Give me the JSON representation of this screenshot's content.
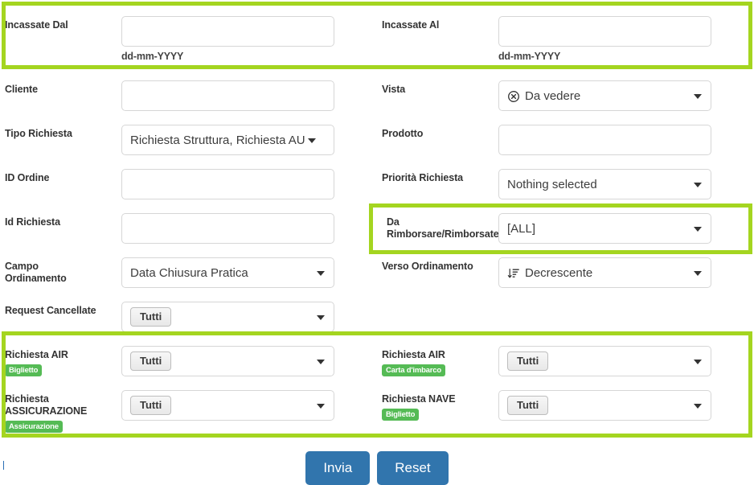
{
  "colors": {
    "highlight_green": "#a4d520",
    "badge_green": "#55bb55",
    "button_blue": "#3175ad"
  },
  "form": {
    "rows": [
      {
        "left": {
          "label": "Incassate Dal",
          "type": "text",
          "value": "",
          "hint": "dd-mm-YYYY"
        },
        "right": {
          "label": "Incassate Al",
          "type": "text",
          "value": "",
          "hint": "dd-mm-YYYY"
        }
      },
      {
        "left": {
          "label": "Cliente",
          "type": "text",
          "value": ""
        },
        "right": {
          "label": "Vista",
          "type": "select",
          "value": "Da vedere",
          "icon": "circle-x-icon"
        }
      },
      {
        "left": {
          "label": "Tipo Richiesta",
          "type": "select",
          "value": "Richiesta Struttura, Richiesta AU"
        },
        "right": {
          "label": "Prodotto",
          "type": "text",
          "value": ""
        }
      },
      {
        "left": {
          "label": "ID Ordine",
          "type": "text",
          "value": ""
        },
        "right": {
          "label": "Priorità Richiesta",
          "type": "select",
          "value": "Nothing selected"
        }
      },
      {
        "left": {
          "label": "Id Richiesta",
          "type": "text",
          "value": ""
        },
        "right": {
          "label": "Da Rimborsare/Rimborsate",
          "type": "select",
          "value": "[ALL]"
        }
      },
      {
        "left": {
          "label": "Campo Ordinamento",
          "type": "select",
          "value": "Data Chiusura Pratica"
        },
        "right": {
          "label": "Verso Ordinamento",
          "type": "select",
          "value": "Decrescente",
          "icon": "sort-descending-icon"
        }
      },
      {
        "left": {
          "label": "Request Cancellate",
          "type": "select-chip",
          "value": "Tutti"
        },
        "right": null
      },
      {
        "left": {
          "label": "Richiesta AIR",
          "badge": "Biglietto",
          "type": "select-chip",
          "value": "Tutti"
        },
        "right": {
          "label": "Richiesta AIR",
          "badge": "Carta d'imbarco",
          "type": "select-chip",
          "value": "Tutti"
        }
      },
      {
        "left": {
          "label": "Richiesta ASSICURAZIONE",
          "badge": "Assicurazione",
          "type": "select-chip",
          "value": "Tutti"
        },
        "right": {
          "label": "Richiesta NAVE",
          "badge": "Biglietto",
          "type": "select-chip",
          "value": "Tutti"
        }
      }
    ]
  },
  "labels": {
    "incassate_dal": "Incassate Dal",
    "incassate_al": "Incassate Al",
    "date_hint_dal": "dd-mm-YYYY",
    "date_hint_al": "dd-mm-YYYY",
    "cliente": "Cliente",
    "vista": "Vista",
    "tipo_richiesta": "Tipo Richiesta",
    "prodotto": "Prodotto",
    "id_ordine": "ID Ordine",
    "priorita_richiesta": "Priorità Richiesta",
    "id_richiesta": "Id Richiesta",
    "da_rimborsare_line1": "Da",
    "da_rimborsare_line2": "Rimborsare/Rimborsate",
    "campo_ordinamento_line1": "Campo",
    "campo_ordinamento_line2": "Ordinamento",
    "verso_ordinamento": "Verso Ordinamento",
    "request_cancellate": "Request Cancellate",
    "richiesta_air_1": "Richiesta AIR",
    "richiesta_air_2": "Richiesta AIR",
    "richiesta_assicurazione_line1": "Richiesta",
    "richiesta_assicurazione_line2": "ASSICURAZIONE",
    "richiesta_nave": "Richiesta NAVE"
  },
  "badges": {
    "air_biglietto": "Biglietto",
    "air_carta": "Carta d'imbarco",
    "assicurazione": "Assicurazione",
    "nave_biglietto": "Biglietto"
  },
  "values": {
    "vista": "Da vedere",
    "tipo_richiesta": "Richiesta Struttura, Richiesta AU",
    "priorita_richiesta": "Nothing selected",
    "da_rimborsare": "[ALL]",
    "campo_ordinamento": "Data Chiusura Pratica",
    "verso_ordinamento": "Decrescente",
    "request_cancellate": "Tutti",
    "richiesta_air_1": "Tutti",
    "richiesta_air_2": "Tutti",
    "richiesta_assicurazione": "Tutti",
    "richiesta_nave": "Tutti"
  },
  "actions": {
    "submit": "Invia",
    "reset": "Reset"
  }
}
